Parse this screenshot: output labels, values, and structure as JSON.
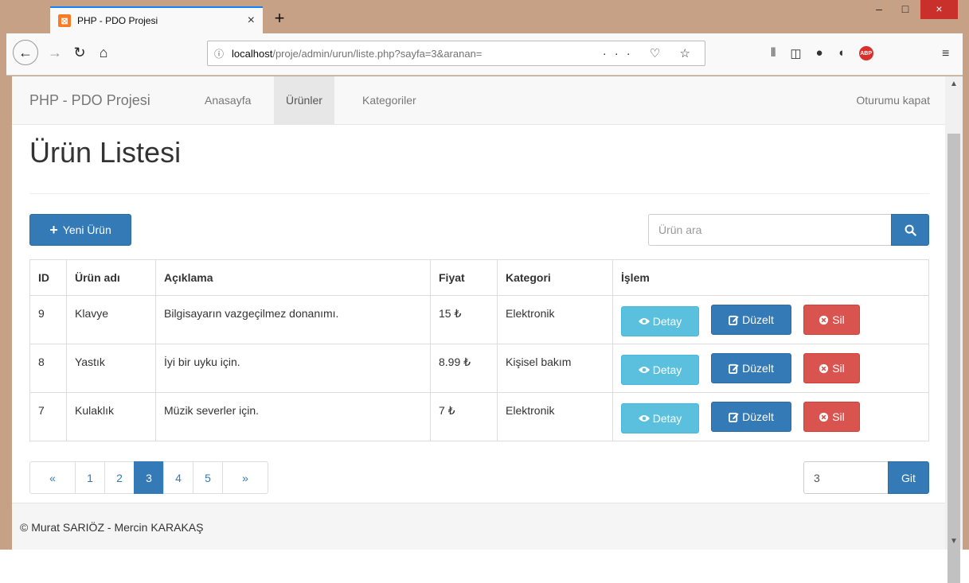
{
  "browser": {
    "tab_title": "PHP - PDO Projesi",
    "tab_close": "×",
    "new_tab": "+",
    "url_host": "localhost",
    "url_path": "/proje/admin/urun/liste.php?sayfa=3&aranan=",
    "url_actions": "··· ♡ ☆",
    "win_min": "–",
    "win_max": "□",
    "win_close": "×",
    "menu": "≡",
    "abp": "ABP"
  },
  "nav": {
    "brand": "PHP - PDO Projesi",
    "links": [
      "Anasayfa",
      "Ürünler",
      "Kategoriler"
    ],
    "active": "Ürünler",
    "logout": "Oturumu kapat"
  },
  "page": {
    "title": "Ürün Listesi",
    "new_button": "Yeni Ürün",
    "search_placeholder": "Ürün ara"
  },
  "table": {
    "headers": [
      "ID",
      "Ürün adı",
      "Açıklama",
      "Fiyat",
      "Kategori",
      "İşlem"
    ],
    "rows": [
      {
        "id": "9",
        "name": "Klavye",
        "desc": "Bilgisayarın vazgeçilmez donanımı.",
        "price": "15 ₺",
        "category": "Elektronik"
      },
      {
        "id": "8",
        "name": "Yastık",
        "desc": "İyi bir uyku için.",
        "price": "8.99 ₺",
        "category": "Kişisel bakım"
      },
      {
        "id": "7",
        "name": "Kulaklık",
        "desc": "Müzik severler için.",
        "price": "7 ₺",
        "category": "Elektronik"
      }
    ],
    "actions": {
      "detail": "Detay",
      "edit": "Düzelt",
      "delete": "Sil"
    }
  },
  "pagination": {
    "prev": "«",
    "pages": [
      "1",
      "2",
      "3",
      "4",
      "5"
    ],
    "current": "3",
    "next": "»",
    "goto_value": "3",
    "goto_button": "Git"
  },
  "footer": {
    "text": "© Murat SARIÖZ - Mercin KARAKAŞ"
  },
  "colors": {
    "primary": "#337ab7",
    "info": "#5bc0de",
    "danger": "#d9534f",
    "window_frame": "#c7a185"
  }
}
